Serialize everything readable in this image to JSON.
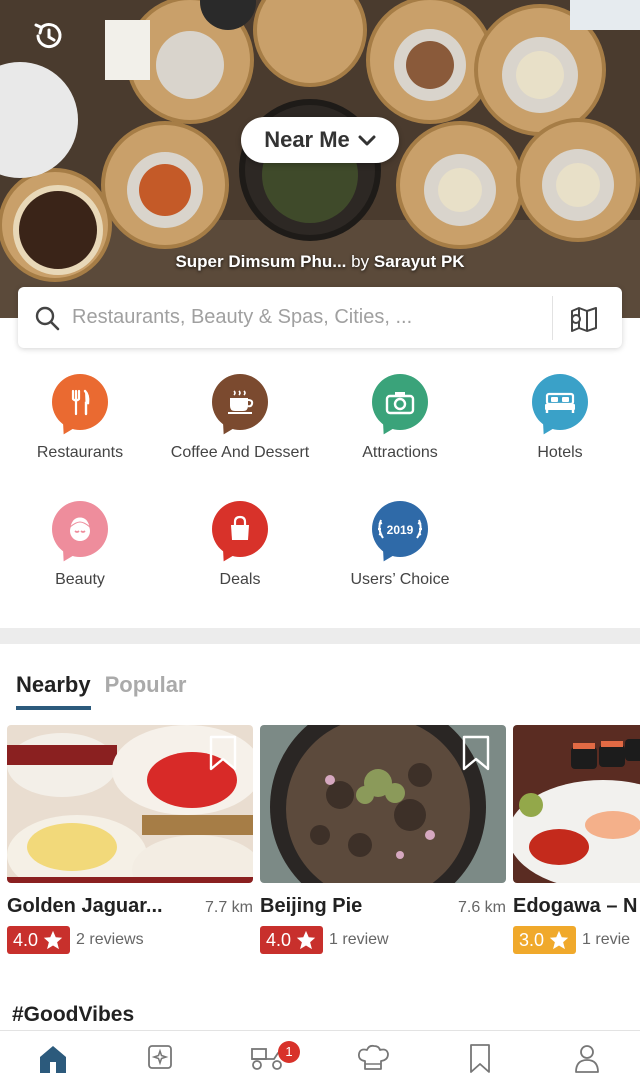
{
  "hero": {
    "near_me_label": "Near Me",
    "photo_title": "Super Dimsum Phu...",
    "photo_by": "by",
    "photo_author": "Sarayut PK"
  },
  "search": {
    "placeholder": "Restaurants, Beauty & Spas, Cities, ..."
  },
  "categories": [
    {
      "label": "Restaurants",
      "color": "#ea6a31",
      "icon": "cutlery-icon"
    },
    {
      "label": "Coffee And Dessert",
      "color": "#7b4a2f",
      "icon": "coffee-cup-icon"
    },
    {
      "label": "Attractions",
      "color": "#3aa37a",
      "icon": "camera-icon"
    },
    {
      "label": "Hotels",
      "color": "#3aa1c8",
      "icon": "bed-icon"
    },
    {
      "label": "Beauty",
      "color": "#ee8d9c",
      "icon": "spa-face-icon"
    },
    {
      "label": "Deals",
      "color": "#d8322a",
      "icon": "shopping-bag-icon"
    },
    {
      "label": "Users’ Choice",
      "color": "#2f6aa8",
      "icon": "laurel-award-icon",
      "badge_text": "2019"
    }
  ],
  "tabs": [
    {
      "label": "Nearby",
      "active": true
    },
    {
      "label": "Popular",
      "active": false
    }
  ],
  "cards": [
    {
      "name": "Golden Jaguar...",
      "distance": "7.7 km",
      "rating": "4.0",
      "rating_color": "#c8302c",
      "reviews": "2 reviews"
    },
    {
      "name": "Beijing Pie",
      "distance": "7.6 km",
      "rating": "4.0",
      "rating_color": "#c8302c",
      "reviews": "1 review"
    },
    {
      "name": "Edogawa – N",
      "distance": "",
      "rating": "3.0",
      "rating_color": "#f0a92b",
      "reviews": "1 revie"
    }
  ],
  "section_title": "#GoodVibes",
  "bottom_nav": {
    "items": [
      "home-icon",
      "discover-icon",
      "delivery-icon",
      "chef-hat-icon",
      "bookmark-icon",
      "profile-icon"
    ],
    "delivery_badge": "1",
    "active_color": "#2c5a7c"
  }
}
